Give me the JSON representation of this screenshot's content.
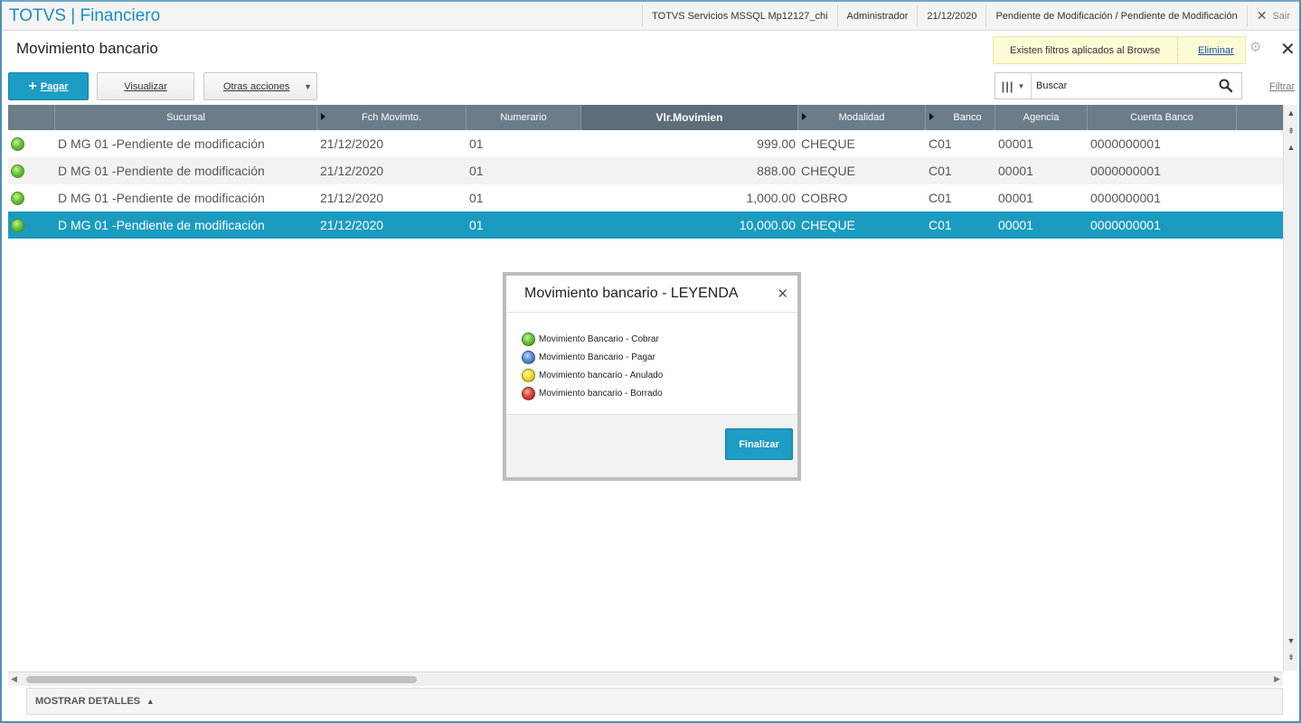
{
  "topbar": {
    "app_title": "TOTVS | Financiero",
    "environment": "TOTVS Servicios MSSQL Mp12127_chi",
    "user": "Administrador",
    "date": "21/12/2020",
    "branch": "Pendiente de Modificación / Pendiente de Modificación",
    "exit_label": "Sair"
  },
  "page": {
    "title": "Movimiento bancario",
    "filter_notice": "Existen filtros aplicados al Browse",
    "filter_remove_label": "Eliminar"
  },
  "toolbar": {
    "pay_label": "Pagar",
    "view_label": "Visualizar",
    "other_actions_label": "Otras acciones",
    "search_placeholder": "Buscar",
    "filter_label": "Filtrar"
  },
  "grid": {
    "columns": [
      "",
      "Sucursal",
      "Fch Movimto.",
      "Numerario",
      "Vlr.Movimien",
      "Modalidad",
      "Banco",
      "Agencia",
      "Cuenta Banco"
    ],
    "rows": [
      {
        "status": "green",
        "sucursal": "D MG 01 -Pendiente de modificación",
        "fecha": "21/12/2020",
        "numerario": "01",
        "valor": "999.00",
        "modalidad": "CHEQUE",
        "banco": "C01",
        "agencia": "00001",
        "cuenta": "0000000001"
      },
      {
        "status": "green",
        "sucursal": "D MG 01 -Pendiente de modificación",
        "fecha": "21/12/2020",
        "numerario": "01",
        "valor": "888.00",
        "modalidad": "CHEQUE",
        "banco": "C01",
        "agencia": "00001",
        "cuenta": "0000000001"
      },
      {
        "status": "green",
        "sucursal": "D MG 01 -Pendiente de modificación",
        "fecha": "21/12/2020",
        "numerario": "01",
        "valor": "1,000.00",
        "modalidad": "COBRO",
        "banco": "C01",
        "agencia": "00001",
        "cuenta": "0000000001"
      },
      {
        "status": "green",
        "sucursal": "D MG 01 -Pendiente de modificación",
        "fecha": "21/12/2020",
        "numerario": "01",
        "valor": "10,000.00",
        "modalidad": "CHEQUE",
        "banco": "C01",
        "agencia": "00001",
        "cuenta": "0000000001"
      }
    ],
    "selected_row": 3
  },
  "footer": {
    "details_label": "MOSTRAR DETALLES"
  },
  "modal": {
    "title": "Movimiento bancario - LEYENDA",
    "items": [
      {
        "color": "green",
        "label": "Movimiento Bancario - Cobrar"
      },
      {
        "color": "blue",
        "label": "Movimiento Bancario - Pagar"
      },
      {
        "color": "yellow",
        "label": "Movimiento bancario - Anulado"
      },
      {
        "color": "red",
        "label": "Movimiento bancario - Borrado"
      }
    ],
    "finish_label": "Finalizar"
  },
  "colors": {
    "accent": "#1d9cc4",
    "header_bg": "#6c7c88",
    "selected_row": "#1b9bc0"
  }
}
